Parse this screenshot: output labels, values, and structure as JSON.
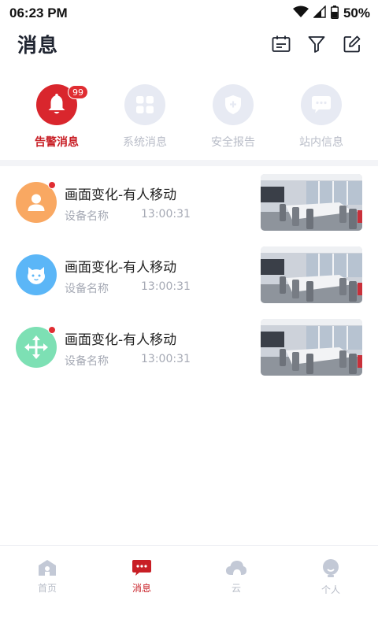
{
  "status_bar": {
    "time": "06:23 PM",
    "battery": "50%"
  },
  "header": {
    "title": "消息"
  },
  "categories": [
    {
      "label": "告警消息",
      "badge": "99",
      "active": true
    },
    {
      "label": "系统消息",
      "active": false
    },
    {
      "label": "安全报告",
      "active": false
    },
    {
      "label": "站内信息",
      "active": false
    }
  ],
  "messages": [
    {
      "title": "画面变化-有人移动",
      "device": "设备名称",
      "time": "13:00:31",
      "unread": true,
      "avatar_color": "#f9a862",
      "avatar_icon": "person-icon"
    },
    {
      "title": "画面变化-有人移动",
      "device": "设备名称",
      "time": "13:00:31",
      "unread": false,
      "avatar_color": "#5bb6f7",
      "avatar_icon": "pet-face-icon"
    },
    {
      "title": "画面变化-有人移动",
      "device": "设备名称",
      "time": "13:00:31",
      "unread": true,
      "avatar_color": "#7de0b4",
      "avatar_icon": "move-arrows-icon"
    }
  ],
  "bottom_nav": [
    {
      "label": "首页",
      "icon": "home-icon",
      "active": false
    },
    {
      "label": "消息",
      "icon": "message-icon",
      "active": true
    },
    {
      "label": "云",
      "icon": "cloud-icon",
      "active": false
    },
    {
      "label": "个人",
      "icon": "lightbulb-icon",
      "active": false
    }
  ],
  "colors": {
    "accent": "#d9262d",
    "inactive": "#b9bdc8"
  }
}
